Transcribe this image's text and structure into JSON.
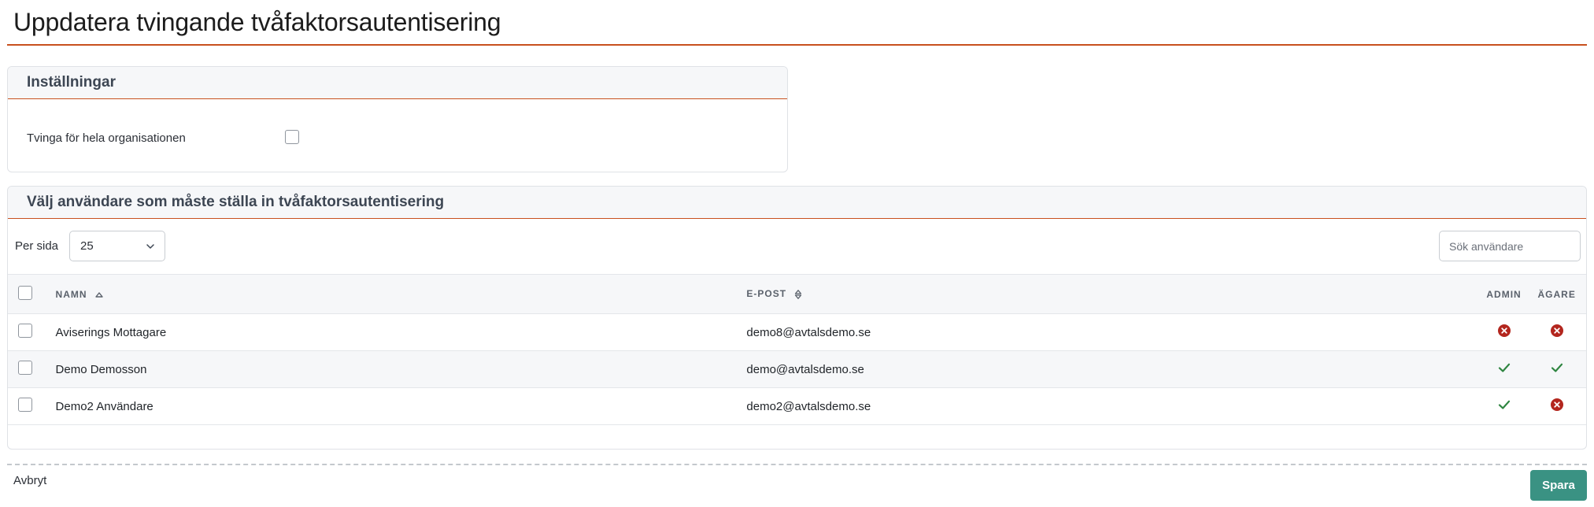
{
  "page": {
    "title": "Uppdatera tvingande tvåfaktorsautentisering",
    "accent_color": "#c8501e"
  },
  "settings": {
    "header": "Inställningar",
    "enforce_org_label": "Tvinga för hela organisationen",
    "enforce_org_checked": false
  },
  "users_section": {
    "header": "Välj användare som måste ställa in tvåfaktorsautentisering",
    "per_page_label": "Per sida",
    "per_page_value": "25",
    "search_placeholder": "Sök användare",
    "columns": {
      "name": "NAMN",
      "email": "E-POST",
      "admin": "ADMIN",
      "owner": "ÄGARE"
    },
    "rows": [
      {
        "name": "Aviserings Mottagare",
        "email": "demo8@avtalsdemo.se",
        "admin": false,
        "owner": false
      },
      {
        "name": "Demo Demosson",
        "email": "demo@avtalsdemo.se",
        "admin": true,
        "owner": true
      },
      {
        "name": "Demo2 Användare",
        "email": "demo2@avtalsdemo.se",
        "admin": true,
        "owner": false
      }
    ]
  },
  "footer": {
    "cancel_label": "Avbryt",
    "save_label": "Spara",
    "save_color": "#3a9283"
  },
  "icons": {
    "yes": "check-icon",
    "no": "x-circle-icon",
    "yes_color": "#2e8540",
    "no_color": "#b3261e"
  }
}
